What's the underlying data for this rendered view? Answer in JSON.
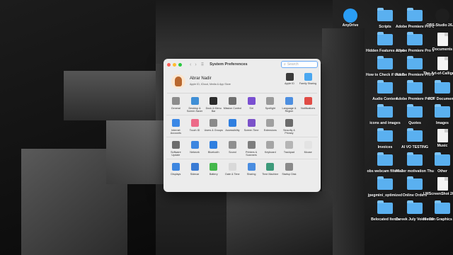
{
  "window": {
    "title": "System Preferences",
    "search_placeholder": "Search",
    "nav_back": "‹",
    "nav_forward": "›",
    "grid_label": "⠿"
  },
  "account": {
    "name": "Abrar Nadir",
    "subtitle": "Apple ID, iCloud, Media & App Store",
    "tiles": [
      {
        "label": "Apple ID",
        "color": "#3b3b3b"
      },
      {
        "label": "Family Sharing",
        "color": "#4aa7f0"
      }
    ]
  },
  "prefs": {
    "rows": [
      [
        {
          "label": "General",
          "color": "#8c8c8c"
        },
        {
          "label": "Desktop & Screen Saver",
          "color": "#3f8fd6"
        },
        {
          "label": "Dock & Menu Bar",
          "color": "#2b2b2b"
        },
        {
          "label": "Mission Control",
          "color": "#6f6f6f"
        },
        {
          "label": "Siri",
          "color": "#7a4fd1"
        },
        {
          "label": "Spotlight",
          "color": "#9a9a9a"
        },
        {
          "label": "Language & Region",
          "color": "#4d8fe0"
        },
        {
          "label": "Notifications",
          "color": "#e04b45"
        }
      ],
      [
        {
          "label": "Internet Accounts",
          "color": "#3b88e6"
        },
        {
          "label": "Touch ID",
          "color": "#ec6a88"
        },
        {
          "label": "Users & Groups",
          "color": "#8a8a8a"
        },
        {
          "label": "Accessibility",
          "color": "#2f7fe0"
        },
        {
          "label": "Screen Time",
          "color": "#7b52c9"
        },
        {
          "label": "Extensions",
          "color": "#a0a0a0"
        },
        {
          "label": "Security & Privacy",
          "color": "#6b6b6b"
        }
      ],
      [
        {
          "label": "Software Update",
          "color": "#6c6c6c"
        },
        {
          "label": "Network",
          "color": "#3d86e0"
        },
        {
          "label": "Bluetooth",
          "color": "#2f7fe0"
        },
        {
          "label": "Sound",
          "color": "#8f8f8f"
        },
        {
          "label": "Printers & Scanners",
          "color": "#7d7d7d"
        },
        {
          "label": "Keyboard",
          "color": "#a5a5a5"
        },
        {
          "label": "Trackpad",
          "color": "#b5b5b5"
        },
        {
          "label": "Mouse",
          "color": "#e3e3e3"
        }
      ],
      [
        {
          "label": "Displays",
          "color": "#3d86e0"
        },
        {
          "label": "Sidecar",
          "color": "#3a7bd5"
        },
        {
          "label": "Battery",
          "color": "#44b84b"
        },
        {
          "label": "Date & Time",
          "color": "#d9d9d9"
        },
        {
          "label": "Sharing",
          "color": "#4a8de0"
        },
        {
          "label": "Time Machine",
          "color": "#3d9a7a"
        },
        {
          "label": "Startup Disk",
          "color": "#8a8a8a"
        }
      ]
    ]
  },
  "desktop": {
    "icons": [
      {
        "label": "AnyDrive",
        "kind": "app",
        "color": "#2a9df4"
      },
      {
        "label": "Scripts",
        "kind": "folder"
      },
      {
        "label": "Adobe Premiere Pro Captured Video",
        "kind": "folder"
      },
      {
        "label": "OBS-Studio 26.1.2",
        "kind": "app",
        "color": "#1e1e1e"
      },
      {
        "label": "Hidden Features of your Ch...ost Views",
        "kind": "folder"
      },
      {
        "label": "Adobe Premiere Pro Video Previews",
        "kind": "folder"
      },
      {
        "label": "Documents",
        "kind": "doc"
      },
      {
        "label": "How to Check if this Nich...al or Not",
        "kind": "folder"
      },
      {
        "label": "Adobe Premiere Pro Audio Previews",
        "kind": "folder"
      },
      {
        "label": "The-Art-of-Calligraphy.pptx",
        "kind": "doc"
      },
      {
        "label": "Audio Content",
        "kind": "folder"
      },
      {
        "label": "Adobe Premiere Pro Auto-Save",
        "kind": "folder"
      },
      {
        "label": "PDF Documents",
        "kind": "folder"
      },
      {
        "label": "icons and images",
        "kind": "folder"
      },
      {
        "label": "Quotes",
        "kind": "folder"
      },
      {
        "label": "Images",
        "kind": "folder"
      },
      {
        "label": "Invoices",
        "kind": "folder"
      },
      {
        "label": "AI VO TESTING",
        "kind": "folder"
      },
      {
        "label": "Music",
        "kind": "doc"
      },
      {
        "label": "obs webcam filters 2",
        "kind": "folder"
      },
      {
        "label": "Mister motivation Thumbnails",
        "kind": "folder"
      },
      {
        "label": "Other",
        "kind": "folder"
      },
      {
        "label": "jpegmini_optimized",
        "kind": "folder"
      },
      {
        "label": "Online Orders",
        "kind": "folder"
      },
      {
        "label": "LWScreenShot 2023-0....21.48 PM",
        "kind": "doc"
      },
      {
        "label": "Belocated Items",
        "kind": "folder"
      },
      {
        "label": "Zareek July Voices 2022",
        "kind": "folder"
      },
      {
        "label": "Motion Graphics Template Media",
        "kind": "folder"
      }
    ]
  }
}
